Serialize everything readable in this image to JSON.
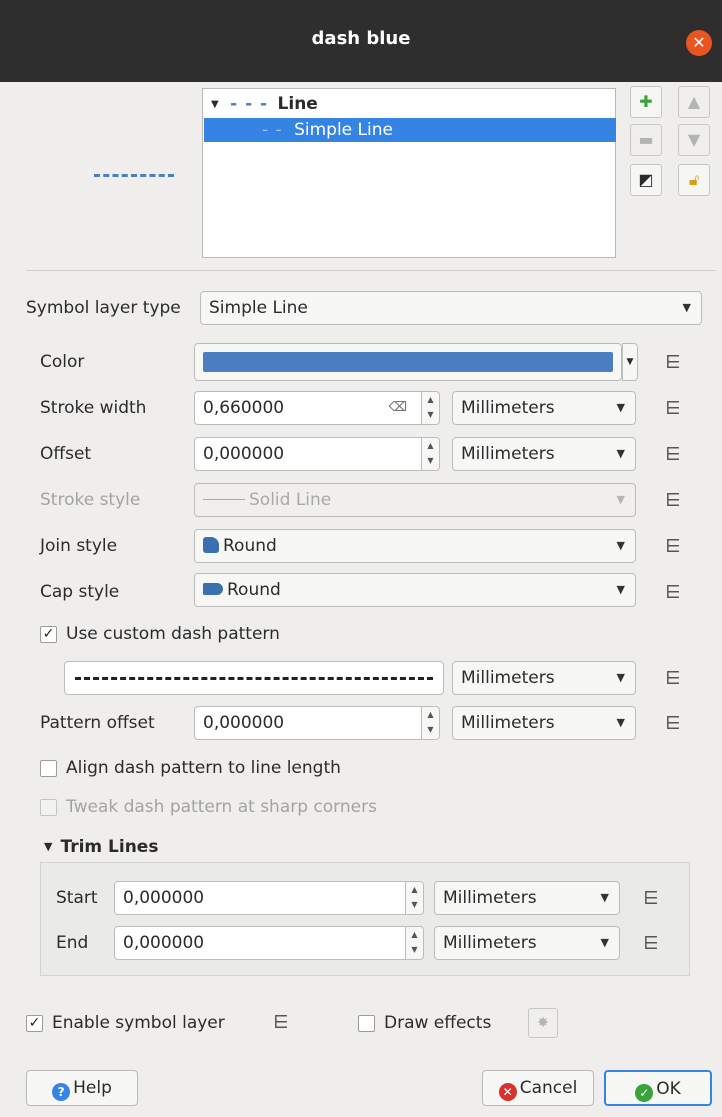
{
  "window": {
    "title": "dash blue"
  },
  "tree": {
    "root_label": "Line",
    "child_label": "Simple Line"
  },
  "symbol_layer_type": {
    "label": "Symbol layer type",
    "value": "Simple Line"
  },
  "color": {
    "label": "Color",
    "value_hex": "#4a7fc1"
  },
  "stroke_width": {
    "label": "Stroke width",
    "value": "0,660000",
    "unit": "Millimeters"
  },
  "offset": {
    "label": "Offset",
    "value": "0,000000",
    "unit": "Millimeters"
  },
  "stroke_style": {
    "label": "Stroke style",
    "value": "Solid Line"
  },
  "join_style": {
    "label": "Join style",
    "value": "Round"
  },
  "cap_style": {
    "label": "Cap style",
    "value": "Round"
  },
  "custom_dash": {
    "label": "Use custom dash pattern",
    "checked": true,
    "unit": "Millimeters"
  },
  "pattern_offset": {
    "label": "Pattern offset",
    "value": "0,000000",
    "unit": "Millimeters"
  },
  "align_dash": {
    "label": "Align dash pattern to line length",
    "checked": false
  },
  "tweak_dash": {
    "label": "Tweak dash pattern at sharp corners",
    "checked": false
  },
  "trim_lines": {
    "title": "Trim Lines",
    "start": {
      "label": "Start",
      "value": "0,000000",
      "unit": "Millimeters"
    },
    "end": {
      "label": "End",
      "value": "0,000000",
      "unit": "Millimeters"
    }
  },
  "enable_layer": {
    "label": "Enable symbol layer",
    "checked": true
  },
  "draw_effects": {
    "label": "Draw effects",
    "checked": false
  },
  "buttons": {
    "help": "Help",
    "cancel": "Cancel",
    "ok": "OK"
  },
  "colors": {
    "accent": "#3584e4",
    "close": "#e95420",
    "cancel_icon": "#d6322e",
    "ok_icon": "#3aa33a"
  }
}
